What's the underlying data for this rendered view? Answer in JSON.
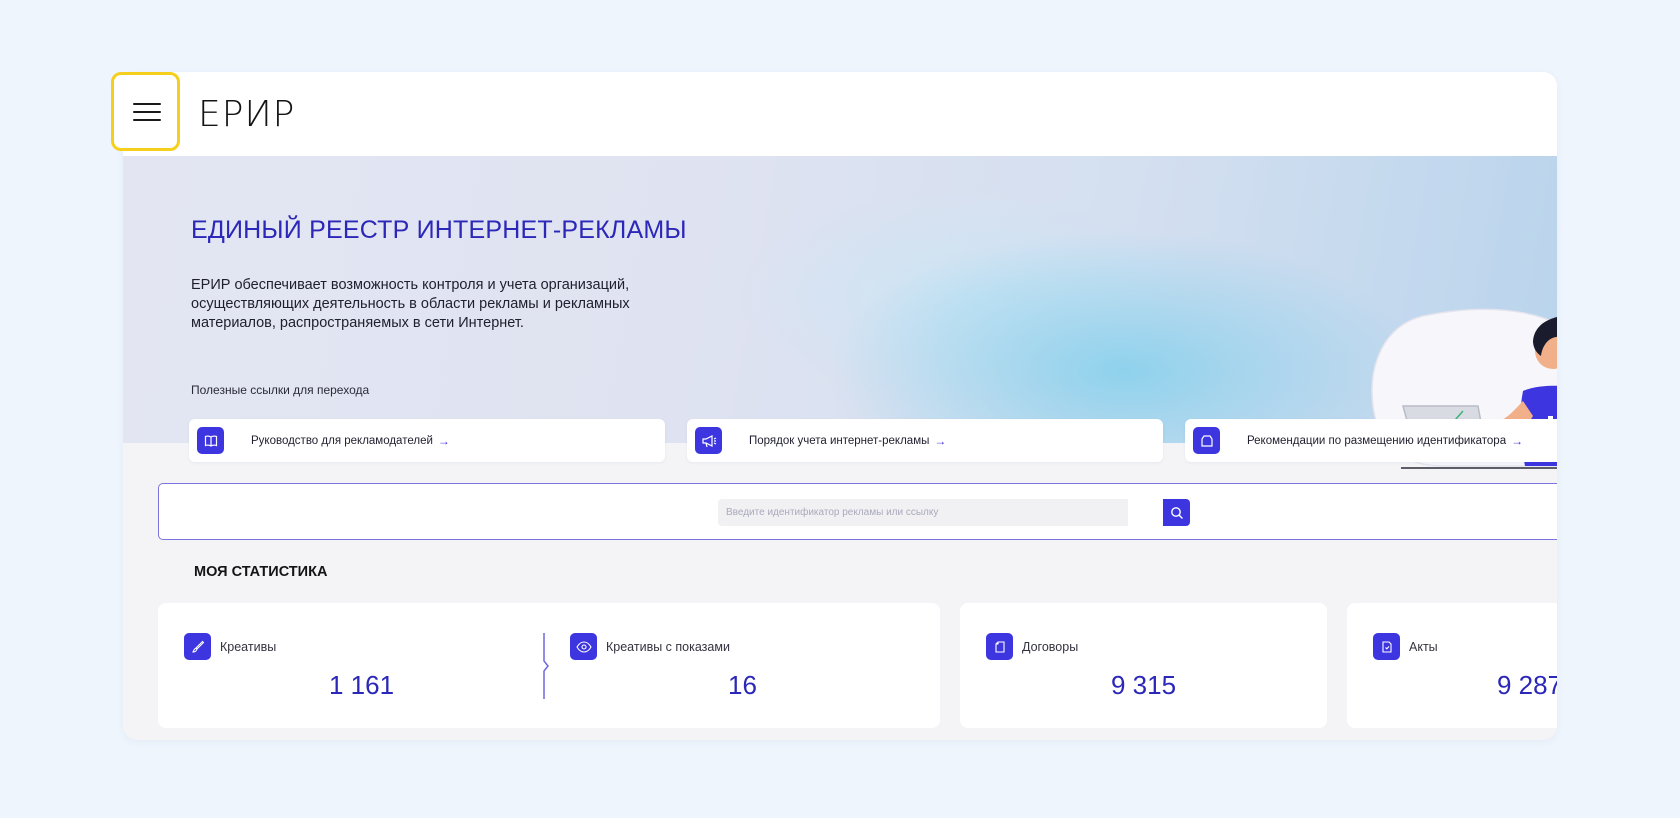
{
  "header": {
    "logo": "ЕРИР",
    "menu_icon": "hamburger-menu-icon"
  },
  "hero": {
    "title": "ЕДИНЫЙ РЕЕСТР ИНТЕРНЕТ-РЕКЛАМЫ",
    "description": "ЕРИР обеспечивает возможность контроля и учета организаций, осуществляющих деятельность в области рекламы и рекламных материалов, распространяемых в сети Интернет.",
    "links_caption": "Полезные ссылки для перехода"
  },
  "links": [
    {
      "label": "Руководство для рекламодателей",
      "icon": "book-icon"
    },
    {
      "label": "Порядок учета интернет-рекламы",
      "icon": "megaphone-icon"
    },
    {
      "label": "Рекомендации по размещению идентификатора",
      "icon": "tag-icon"
    }
  ],
  "search": {
    "placeholder": "Введите идентификатор рекламы или ссылку",
    "icon": "search-icon"
  },
  "stats": {
    "title": "МОЯ СТАТИСТИКА",
    "items": [
      {
        "label": "Креативы",
        "value": "1 161",
        "icon": "brush-icon"
      },
      {
        "label": "Креативы с показами",
        "value": "16",
        "icon": "eye-icon"
      },
      {
        "label": "Договоры",
        "value": "9 315",
        "icon": "document-icon"
      },
      {
        "label": "Акты",
        "value": "9 287",
        "icon": "file-check-icon"
      }
    ]
  },
  "colors": {
    "accent": "#3d35e0",
    "title": "#2b27b8",
    "highlight": "#f6cf1d"
  }
}
